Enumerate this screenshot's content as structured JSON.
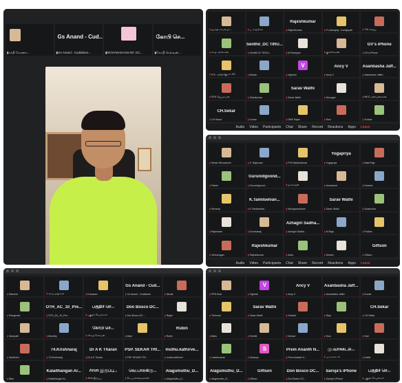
{
  "panelA": {
    "strip": [
      {
        "name": "",
        "caption": "சக்தி கோணா..."
      },
      {
        "name": "Gs Anand - Cud...",
        "caption": "Gs Anand - Cuddalore..."
      },
      {
        "name": "",
        "caption": "MOHANADASS-DF, DC..."
      },
      {
        "name": "கோபி செ...",
        "caption": "கோபி செல்வன்..."
      }
    ]
  },
  "panelB": {
    "title": "",
    "tiles": [
      {
        "name": "",
        "avatar": "a1",
        "caption": "ஜமாதி காவல் நா..."
      },
      {
        "name": "",
        "avatar": "a2",
        "caption": "ப. ராஜசேகர்"
      },
      {
        "name": "Rajeshkumar",
        "avatar": "",
        "caption": "Rajeshkumar"
      },
      {
        "name": "",
        "avatar": "a3",
        "caption": "P. Antonyraj - Kurinjipadi"
      },
      {
        "name": "",
        "avatar": "a4",
        "caption": "T.M. விஜய்"
      },
      {
        "name": "",
        "avatar": "a5",
        "caption": "கா.த. அசோகன்"
      },
      {
        "name": "Senthil_DC TIRU...",
        "avatar": "",
        "caption": "Senthil DC TIRUV..."
      },
      {
        "name": "",
        "avatar": "a6",
        "caption": "M.Pandiyan"
      },
      {
        "name": "",
        "avatar": "a1",
        "caption": "குணசேகரன்"
      },
      {
        "name": "GV's iPhone",
        "avatar": "",
        "caption": "GV's iPhone"
      },
      {
        "name": "",
        "avatar": "a3",
        "caption": "திரு. முத்துக்குமார் DC"
      },
      {
        "name": "",
        "avatar": "a2",
        "caption": "Mohan"
      },
      {
        "name": "V",
        "avatar": "v",
        "caption": "Vignesh"
      },
      {
        "name": "Ancy V",
        "avatar": "",
        "caption": "Ancy V"
      },
      {
        "name": "Asanbasha Jaff...",
        "avatar": "",
        "caption": "Asanbasha Jaffer..."
      },
      {
        "name": "",
        "avatar": "a4",
        "caption": "PDS ஜெயராமன்"
      },
      {
        "name": "",
        "avatar": "a5",
        "caption": "Selvakumar"
      },
      {
        "name": "Sarav Wathi",
        "avatar": "",
        "caption": "Sarav Wathi"
      },
      {
        "name": "",
        "avatar": "a6",
        "caption": "Murugan"
      },
      {
        "name": "",
        "avatar": "a1",
        "caption": "MKS மணிவண்ணன்"
      },
      {
        "name": "CH.Sekar",
        "avatar": "",
        "caption": "CH.Sekar"
      },
      {
        "name": "",
        "avatar": "a2",
        "caption": "Kumar"
      },
      {
        "name": "",
        "avatar": "a3",
        "caption": "DMK Rajan"
      },
      {
        "name": "",
        "avatar": "a4",
        "caption": "Ravi"
      },
      {
        "name": "",
        "avatar": "a5",
        "caption": "Sundar"
      }
    ]
  },
  "panelC": {
    "title": "",
    "tiles": [
      {
        "name": "",
        "avatar": "a1",
        "caption": "Sriram Bhuvanesh"
      },
      {
        "name": "",
        "avatar": "a2",
        "caption": "S. Rajkumar"
      },
      {
        "name": "",
        "avatar": "a3",
        "caption": "PVS Balakrishnan"
      },
      {
        "name": "Yogapriya",
        "avatar": "",
        "caption": "Yogapriya"
      },
      {
        "name": "",
        "avatar": "a4",
        "caption": "Bala Raja"
      },
      {
        "name": "",
        "avatar": "a5",
        "caption": "Palani"
      },
      {
        "name": "Gurunidgoond...",
        "avatar": "",
        "caption": "Gurunidgoond..."
      },
      {
        "name": "",
        "avatar": "a6",
        "caption": "நாகராஜன்"
      },
      {
        "name": "",
        "avatar": "a1",
        "caption": "Annadurai"
      },
      {
        "name": "",
        "avatar": "a2",
        "caption": "Kannan"
      },
      {
        "name": "",
        "avatar": "a3",
        "caption": "Selvaraj"
      },
      {
        "name": "K.Tamilselvan...",
        "avatar": "",
        "caption": "K.Tamilselvan..."
      },
      {
        "name": "",
        "avatar": "a4",
        "caption": "Muruganantham"
      },
      {
        "name": "Sarav Wathi",
        "avatar": "",
        "caption": "Sarav Wathi"
      },
      {
        "name": "",
        "avatar": "a5",
        "caption": "Sivakumar"
      },
      {
        "name": "",
        "avatar": "a6",
        "caption": "Rajendran"
      },
      {
        "name": "",
        "avatar": "a1",
        "caption": "Govindaraj"
      },
      {
        "name": "Azhagiri Sadha...",
        "avatar": "",
        "caption": "Azhagiri Sadha..."
      },
      {
        "name": "",
        "avatar": "a2",
        "caption": "M.Raja"
      },
      {
        "name": "",
        "avatar": "a3",
        "caption": "Prabhu"
      },
      {
        "name": "",
        "avatar": "a4",
        "caption": "Velmurugan"
      },
      {
        "name": "Rajeshkumar",
        "avatar": "",
        "caption": "Rajeshkumar"
      },
      {
        "name": "",
        "avatar": "a5",
        "caption": "Anbu"
      },
      {
        "name": "",
        "avatar": "a6",
        "caption": "Dinesh"
      },
      {
        "name": "Giftson",
        "avatar": "",
        "caption": "Giftson"
      }
    ]
  },
  "panelD": {
    "title": "",
    "tiles": [
      {
        "name": "",
        "avatar": "a1",
        "caption": "Ramesh"
      },
      {
        "name": "",
        "avatar": "a2",
        "caption": "அ.ந.முனுசாமி"
      },
      {
        "name": "",
        "avatar": "a3",
        "caption": "Kumaran"
      },
      {
        "name": "Gs Anand - Cud...",
        "avatar": "",
        "caption": "Gs Anand - Cuddalore"
      },
      {
        "name": "",
        "avatar": "a4",
        "caption": "Murali"
      },
      {
        "name": "",
        "avatar": "a5",
        "caption": "Elangovan"
      },
      {
        "name": "OTH_AC_10_Pre...",
        "avatar": "",
        "caption": "OTH_AC_10_Pre..."
      },
      {
        "name": "பகுதிச் செ...",
        "avatar": "",
        "caption": "பகுதிச் செயலாளர்"
      },
      {
        "name": "Don Bosco DC...",
        "avatar": "",
        "caption": "Don Bosco DC..."
      },
      {
        "name": "",
        "avatar": "a6",
        "caption": "Rajan"
      },
      {
        "name": "",
        "avatar": "a1",
        "caption": "Sampath"
      },
      {
        "name": "",
        "avatar": "a2",
        "caption": "Moorthy"
      },
      {
        "name": "கோபி செ...",
        "avatar": "",
        "caption": "கோபி செல்வன்"
      },
      {
        "name": "",
        "avatar": "a3",
        "caption": "Mani"
      },
      {
        "name": "Rubin",
        "avatar": "",
        "caption": "Rubin"
      },
      {
        "name": "",
        "avatar": "a4",
        "caption": "Santhosh"
      },
      {
        "name": "74.Krishnaraj",
        "avatar": "",
        "caption": "74.Krishnaraj"
      },
      {
        "name": "Dr A K Tharan",
        "avatar": "",
        "caption": "Dr A K Tharan"
      },
      {
        "name": "PSP. SEKAR TRI...",
        "avatar": "",
        "caption": "PSP. SEKAR TRI..."
      },
      {
        "name": "muthu.kathirve...",
        "avatar": "",
        "caption": "muthu.kathirvel"
      },
      {
        "name": "",
        "avatar": "a5",
        "caption": "Balu"
      },
      {
        "name": "Kalaithangan Ar...",
        "avatar": "",
        "caption": "Kalaithangan Ar..."
      },
      {
        "name": "Arun இருப்பு...",
        "avatar": "",
        "caption": "Arun இருப்பு"
      },
      {
        "name": "வெ.பாலகிரு...",
        "avatar": "",
        "caption": "வெ.பாலகிருஷ்ணன்"
      },
      {
        "name": "Alagumuthu_D...",
        "avatar": "",
        "caption": "Alagumuthu_D..."
      }
    ]
  },
  "panelE": {
    "title": "",
    "tiles": [
      {
        "name": "",
        "avatar": "a1",
        "caption": "PRS.Ravi"
      },
      {
        "name": "V",
        "avatar": "v",
        "caption": "Vignesh"
      },
      {
        "name": "Ancy V",
        "avatar": "",
        "caption": "Ancy V"
      },
      {
        "name": "Asanbasha Jaff...",
        "avatar": "",
        "caption": "Asanbasha Jaffer"
      },
      {
        "name": "",
        "avatar": "a2",
        "caption": "Kumar"
      },
      {
        "name": "",
        "avatar": "a3",
        "caption": "Thirumal"
      },
      {
        "name": "Sarav Wathi",
        "avatar": "",
        "caption": "Sarav Wathi"
      },
      {
        "name": "",
        "avatar": "a4",
        "caption": "Ganesh"
      },
      {
        "name": "",
        "avatar": "a5",
        "caption": "Raju"
      },
      {
        "name": "CH.Sekar",
        "avatar": "",
        "caption": "CH.Sekar"
      },
      {
        "name": "",
        "avatar": "a6",
        "caption": "Babu"
      },
      {
        "name": "",
        "avatar": "a1",
        "caption": "Senthil"
      },
      {
        "name": "",
        "avatar": "a2",
        "caption": "Venkat"
      },
      {
        "name": "",
        "avatar": "a3",
        "caption": "Siva"
      },
      {
        "name": "",
        "avatar": "a4",
        "caption": "Hari"
      },
      {
        "name": "",
        "avatar": "a5",
        "caption": "Lakshmanan"
      },
      {
        "name": "S",
        "avatar": "s",
        "caption": "Saranya"
      },
      {
        "name": "Prem Ananth N...",
        "avatar": "",
        "caption": "Prem Ananth N..."
      },
      {
        "name": "மு.வாசுகடல்...",
        "avatar": "",
        "caption": "மு.வாசுகடல்"
      },
      {
        "name": "",
        "avatar": "a6",
        "caption": "Kathir"
      },
      {
        "name": "Alagumuthu_D...",
        "avatar": "",
        "caption": "Alagumuthu_D..."
      },
      {
        "name": "Giftson",
        "avatar": "",
        "caption": "Giftson"
      },
      {
        "name": "Don Bosco DC...",
        "avatar": "",
        "caption": "Don Bosco DC..."
      },
      {
        "name": "Saroja's iPhone",
        "avatar": "",
        "caption": "Saroja's iPhone"
      },
      {
        "name": "பகுதிச் செ...",
        "avatar": "",
        "caption": "பகுதிச் செயலாளர்"
      }
    ]
  },
  "toolbar": {
    "items": [
      "Audio",
      "Video",
      "Participants",
      "Chat",
      "Share",
      "Record",
      "Reactions",
      "Apps",
      "Leave"
    ],
    "leave_label": "Leave"
  },
  "colors": {
    "panel_bg": "#1f2123",
    "tile_bg": "#161718",
    "mic_off": "#e0352b",
    "shirt": "#c6ef4a"
  }
}
